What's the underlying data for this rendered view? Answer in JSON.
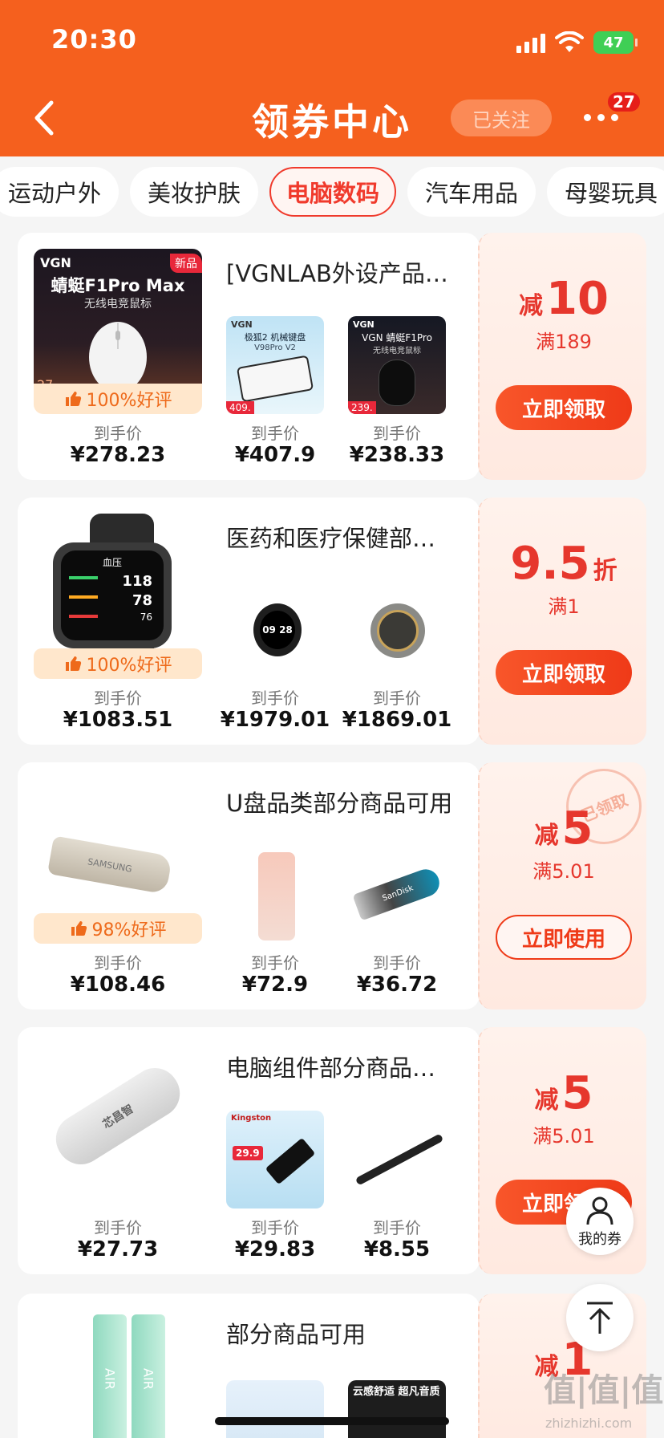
{
  "status": {
    "time": "20:30",
    "battery": "47"
  },
  "header": {
    "title": "领券中心",
    "follow": "已关注",
    "badge": "27"
  },
  "tabs": [
    "运动户外",
    "美妆护肤",
    "电脑数码",
    "汽车用品",
    "母婴玩具"
  ],
  "active_tab": "电脑数码",
  "common": {
    "price_label": "到手价"
  },
  "cards": [
    {
      "title": "[VGNLAB外设产品…",
      "rating": "100%好评",
      "main_img_text": {
        "brand": "VGN",
        "name": "蜻蜓F1Pro Max",
        "sub": "无线电竞鼠标",
        "tag": "新品",
        "price_tag": "27"
      },
      "sub1_text": {
        "brand": "VGN",
        "name": "极狐2 机械键盘",
        "sub": "V98Pro V2",
        "price_tag": "409."
      },
      "sub2_text": {
        "brand": "VGN",
        "name": "VGN 蜻蜓F1Pro",
        "sub": "无线电竞鼠标",
        "price_tag": "239."
      },
      "prices": [
        "¥278.23",
        "¥407.9",
        "¥238.33"
      ],
      "coupon": {
        "prefix": "减",
        "amount": "10",
        "suffix": "",
        "condition": "满189",
        "button": "立即领取"
      }
    },
    {
      "title": "医药和医疗保健部…",
      "rating": "100%好评",
      "watch_text": {
        "label": "血压",
        "v1": "118",
        "v2": "78",
        "v3": "76",
        "time": "09 28"
      },
      "prices": [
        "¥1083.51",
        "¥1979.01",
        "¥1869.01"
      ],
      "coupon": {
        "prefix": "",
        "amount": "9.5",
        "suffix": "折",
        "condition": "满1",
        "button": "立即领取"
      }
    },
    {
      "title": "U盘品类部分商品可用",
      "rating": "98%好评",
      "usb_text": {
        "samsung": "SAMSUNG",
        "sandisk": "SanDisk"
      },
      "prices": [
        "¥108.46",
        "¥72.9",
        "¥36.72"
      ],
      "coupon": {
        "prefix": "减",
        "amount": "5",
        "suffix": "",
        "condition": "满5.01",
        "button": "立即使用",
        "stamp": "已领取"
      }
    },
    {
      "title": "电脑组件部分商品…",
      "usb_text": {
        "brand": "芯昌智",
        "kingston": "Kingston",
        "promo": "29.9"
      },
      "prices": [
        "¥27.73",
        "¥29.83",
        "¥8.55"
      ],
      "coupon": {
        "prefix": "减",
        "amount": "5",
        "suffix": "",
        "condition": "满5.01",
        "button": "立即领取"
      }
    },
    {
      "title": "部分商品可用",
      "battery_text": "AIR",
      "sub2_text": "云感舒适 超凡音质",
      "coupon": {
        "prefix": "减",
        "amount": "1",
        "suffix": ""
      }
    }
  ],
  "floating": {
    "my_coupon": "我的券"
  },
  "watermark": {
    "main": "值|值|值",
    "sub": "zhizhizhi.com"
  },
  "colors": {
    "brand": "#f5601e",
    "accent": "#e6372d"
  }
}
